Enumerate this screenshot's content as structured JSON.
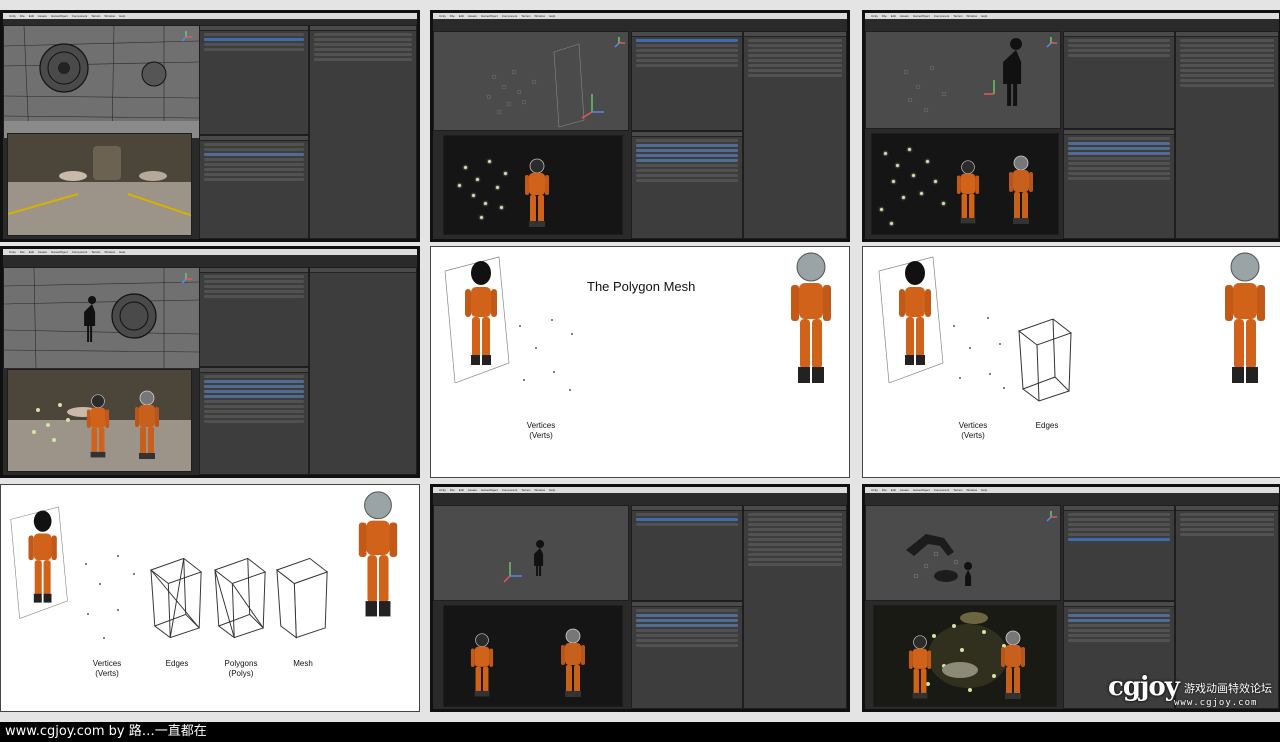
{
  "editor_menu": [
    "Unity",
    "File",
    "Edit",
    "Assets",
    "GameObject",
    "Component",
    "Terrain",
    "Window",
    "Help"
  ],
  "slides": {
    "polygon_title": "The Polygon Mesh",
    "vertices": "Vertices",
    "verts": "(Verts)",
    "edges": "Edges",
    "polygons": "Polygons",
    "polys": "(Polys)",
    "mesh": "Mesh"
  },
  "footer": {
    "caption": "www.cgjoy.com by 路…一直都在"
  },
  "watermark": {
    "logo": "cgjoy",
    "tagline": "游戏动画特效论坛",
    "url": "www.cgjoy.com"
  },
  "colors": {
    "editor_bg": "#3d3d3d",
    "selection": "#3e6ab0",
    "suit_orange": "#d0621a",
    "particle": "#cfe6a0"
  }
}
